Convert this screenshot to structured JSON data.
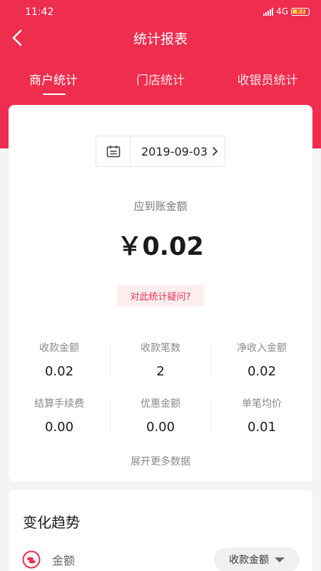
{
  "status_bar": {
    "time": "11:42",
    "network": "4G",
    "battery": "83"
  },
  "header": {
    "title": "统计报表"
  },
  "tabs": [
    {
      "label": "商户统计",
      "active": true
    },
    {
      "label": "门店统计",
      "active": false
    },
    {
      "label": "收银员统计",
      "active": false
    }
  ],
  "summary": {
    "date": "2019-09-03",
    "amount_label": "应到账金额",
    "amount": "￥0.02",
    "question_label": "对此统计疑问?"
  },
  "stats": [
    {
      "label": "收款金额",
      "value": "0.02"
    },
    {
      "label": "收款笔数",
      "value": "2"
    },
    {
      "label": "净收入金额",
      "value": "0.02"
    },
    {
      "label": "结算手续费",
      "value": "0.00"
    },
    {
      "label": "优惠金额",
      "value": "0.00"
    },
    {
      "label": "单笔均价",
      "value": "0.01"
    }
  ],
  "expand_label": "展开更多数据",
  "trend": {
    "title": "变化趋势",
    "legend_label": "金额",
    "selector_value": "收款金额"
  },
  "colors": {
    "accent": "#ef2d4f"
  }
}
